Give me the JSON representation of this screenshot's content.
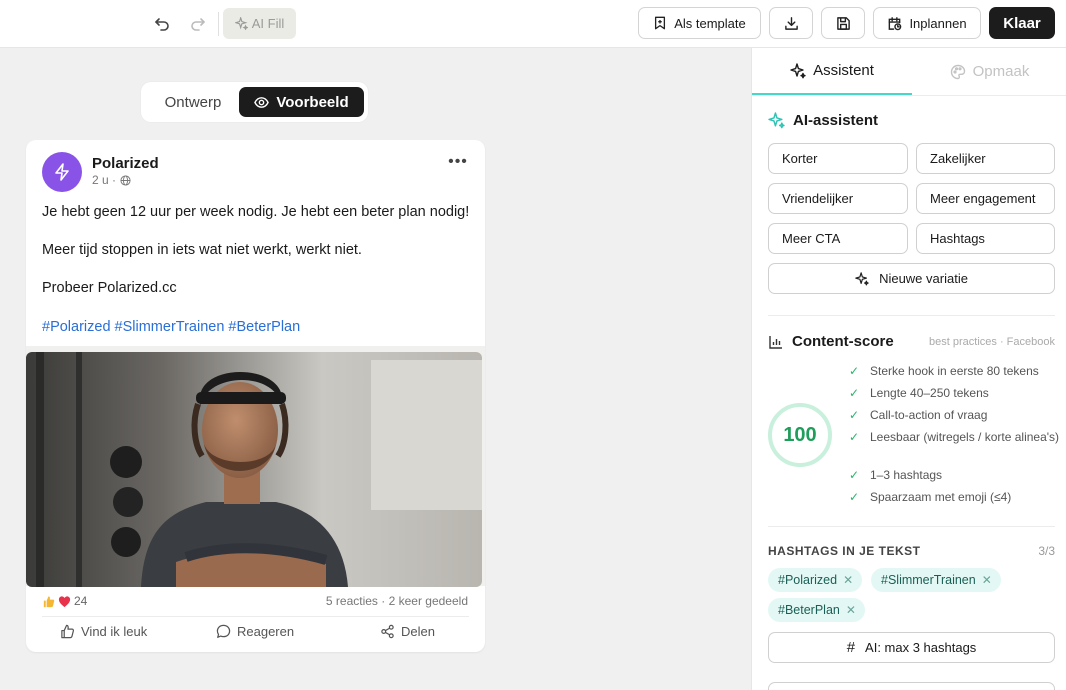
{
  "toolbar": {
    "ai_fill_label": "AI Fill",
    "as_template_label": "Als template",
    "schedule_label": "Inplannen",
    "done_label": "Klaar"
  },
  "view_toggle": {
    "design_label": "Ontwerp",
    "preview_label": "Voorbeeld",
    "active": "Voorbeeld"
  },
  "post": {
    "author": "Polarized",
    "time": "2 u ·",
    "line1": "Je hebt geen 12 uur per week nodig. Je hebt een beter plan nodig!",
    "line2": "Meer tijd stoppen in iets wat niet werkt, werkt niet.",
    "line3": "Probeer Polarized.cc",
    "hashtags": "#Polarized #SlimmerTrainen #BeterPlan",
    "reaction_count": "24",
    "reaction_info": "5 reacties · 2 keer gedeeld",
    "actions": {
      "like": "Vind ik leuk",
      "comment": "Reageren",
      "share": "Delen"
    },
    "avatar_color": "#8a53e8",
    "hashtag_color": "#2a6fd6"
  },
  "panel": {
    "tabs": {
      "assistant": "Assistent",
      "layout": "Opmaak",
      "active": "Assistent"
    },
    "ai_assistant": {
      "title": "AI-assistent",
      "buttons": [
        "Korter",
        "Zakelijker",
        "Vriendelijker",
        "Meer engagement",
        "Meer CTA",
        "Hashtags"
      ],
      "new_variation": "Nieuwe variatie"
    },
    "content_score": {
      "title": "Content-score",
      "source": "best practices · Facebook",
      "score": "100",
      "checks": [
        "Sterke hook in eerste 80 tekens",
        "Lengte 40–250 tekens",
        "Call-to-action of vraag",
        "Leesbaar (witregels / korte alinea's)",
        "1–3 hashtags",
        "Spaarzaam met emoji (≤4)"
      ]
    },
    "hashtags": {
      "title": "HASHTAGS IN JE TEKST",
      "count": "3/3",
      "tags": [
        "#Polarized",
        "#SlimmerTrainen",
        "#BeterPlan"
      ],
      "ai_button": "AI: max 3 hashtags"
    },
    "accent_color": "#4ad5c9",
    "score_color": "#1f9d5a"
  }
}
